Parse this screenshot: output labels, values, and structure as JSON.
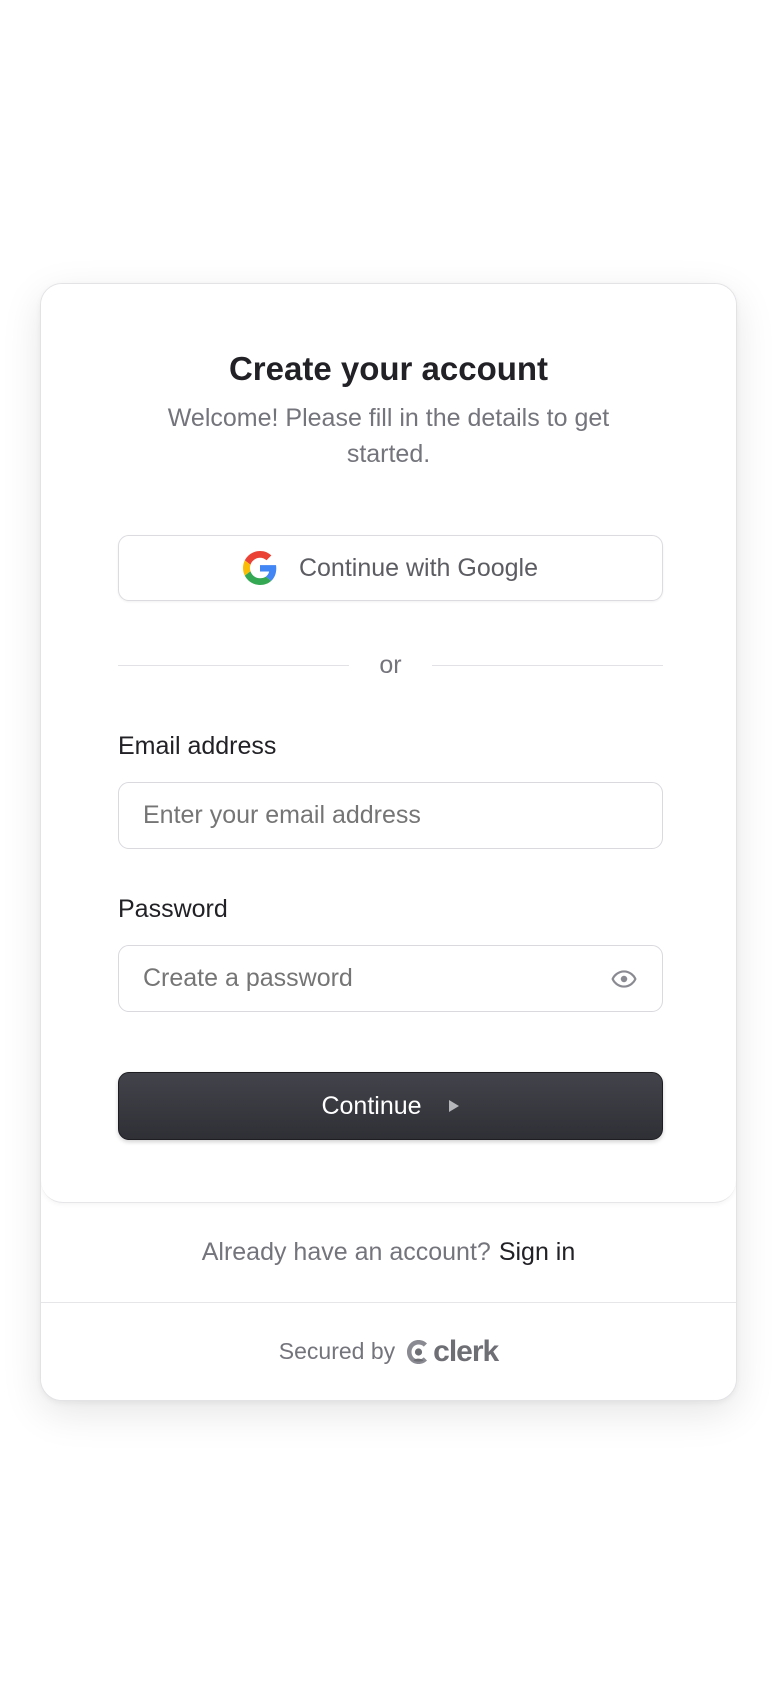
{
  "header": {
    "title": "Create your account",
    "subtitle": "Welcome! Please fill in the details to get started."
  },
  "social": {
    "google_label": "Continue with Google",
    "google_icon": "google-icon"
  },
  "divider": {
    "text": "or"
  },
  "form": {
    "email": {
      "label": "Email address",
      "placeholder": "Enter your email address",
      "value": ""
    },
    "password": {
      "label": "Password",
      "placeholder": "Create a password",
      "value": "",
      "toggle_icon": "eye-icon"
    },
    "submit_label": "Continue",
    "submit_icon": "play-arrow-icon"
  },
  "footer": {
    "prompt": "Already have an account?",
    "signin_link": "Sign in",
    "secured_by": "Secured by",
    "brand": "clerk"
  },
  "colors": {
    "primary_button": "#2f2f36",
    "text_primary": "#212126",
    "text_secondary": "#74747c",
    "google_blue": "#4285F4",
    "google_red": "#EA4335",
    "google_yellow": "#FBBC05",
    "google_green": "#34A853"
  }
}
